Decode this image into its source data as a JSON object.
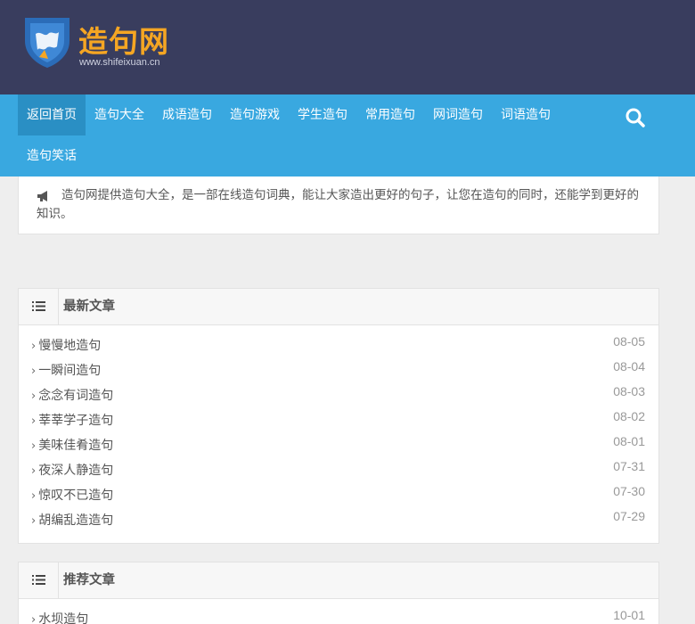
{
  "site": {
    "logo_text": "造句网",
    "logo_url": "www.shifeixuan.cn"
  },
  "nav": {
    "items": [
      {
        "label": "返回首页",
        "active": true
      },
      {
        "label": "造句大全"
      },
      {
        "label": "成语造句"
      },
      {
        "label": "造句游戏"
      },
      {
        "label": "学生造句"
      },
      {
        "label": "常用造句"
      },
      {
        "label": "网词造句"
      },
      {
        "label": "词语造句"
      },
      {
        "label": "造句笑话"
      }
    ],
    "search_icon": "search-icon"
  },
  "notice": {
    "icon": "bullhorn-icon",
    "text": "造句网提供造句大全，是一部在线造句词典，能让大家造出更好的句子，让您在造句的同时，还能学到更好的知识。"
  },
  "latest": {
    "title": "最新文章",
    "icon": "list-icon",
    "items": [
      {
        "title": "慢慢地造句",
        "date": "08-05"
      },
      {
        "title": "一瞬间造句",
        "date": "08-04"
      },
      {
        "title": "念念有词造句",
        "date": "08-03"
      },
      {
        "title": "莘莘学子造句",
        "date": "08-02"
      },
      {
        "title": "美味佳肴造句",
        "date": "08-01"
      },
      {
        "title": "夜深人静造句",
        "date": "07-31"
      },
      {
        "title": "惊叹不已造句",
        "date": "07-30"
      },
      {
        "title": "胡编乱造造句",
        "date": "07-29"
      }
    ]
  },
  "recommended": {
    "title": "推荐文章",
    "icon": "list-icon",
    "items": [
      {
        "title": "水坝造句",
        "date": "10-01"
      }
    ]
  },
  "colors": {
    "header_bg": "#393d5e",
    "nav_bg": "#39a8e0",
    "nav_active": "#2a8fc4",
    "logo_accent": "#f5a623"
  }
}
